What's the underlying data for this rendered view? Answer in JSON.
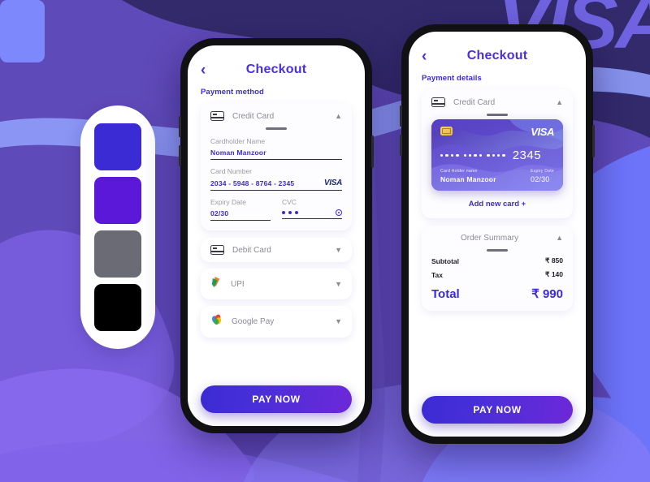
{
  "background": {
    "watermark_text": "VISA",
    "base_color": "#5f4ab9",
    "accent_light": "#6d74fa",
    "accent_dark": "#332a6b"
  },
  "palette": {
    "name": "color-swatches",
    "swatches": [
      {
        "name": "blue-violet",
        "hex": "#3b2bd4"
      },
      {
        "name": "purple",
        "hex": "#5b18d8"
      },
      {
        "name": "gray",
        "hex": "#6b6b75"
      },
      {
        "name": "black",
        "hex": "#000000"
      }
    ]
  },
  "phone1": {
    "header": {
      "back_icon": "chevron-left-icon",
      "title": "Checkout"
    },
    "section_label": "Payment method",
    "credit_card": {
      "icon": "credit-card-icon",
      "label": "Credit Card",
      "chevron": "chevron-up-icon",
      "fields": {
        "cardholder_caption": "Cardholder Name",
        "cardholder_value": "Noman Manzoor",
        "number_caption": "Card Number",
        "number_value": "2034 - 5948 - 8764 - 2345",
        "brand": "VISA",
        "expiry_caption": "Expiry Date",
        "expiry_value": "02/30",
        "cvc_caption": "CVC",
        "cvc_masked": "•••",
        "cvc_toggle_icon": "eye-icon"
      }
    },
    "methods": [
      {
        "icon": "credit-card-icon",
        "label": "Debit Card",
        "chevron": "chevron-down-icon"
      },
      {
        "icon": "upi-icon",
        "label": "UPI",
        "chevron": "chevron-down-icon"
      },
      {
        "icon": "google-pay-icon",
        "label": "Google Pay",
        "chevron": "chevron-down-icon"
      }
    ],
    "pay_button": "PAY NOW"
  },
  "phone2": {
    "header": {
      "back_icon": "chevron-left-icon",
      "title": "Checkout"
    },
    "section_label": "Payment details",
    "credit_card": {
      "icon": "credit-card-icon",
      "label": "Credit Card",
      "chevron": "chevron-up-icon",
      "visual": {
        "brand": "VISA",
        "masked_groups": [
          "••••",
          "••••",
          "••••"
        ],
        "last_four": "2345",
        "holder_caption": "Card Holder name",
        "holder_value": "Noman Manzoor",
        "expiry_caption": "Expiry Date",
        "expiry_value": "02/30"
      },
      "add_new_card": "Add new card +"
    },
    "order_summary": {
      "title": "Order Summary",
      "chevron": "chevron-up-icon",
      "lines": [
        {
          "label": "Subtotal",
          "value": "₹ 850"
        },
        {
          "label": "Tax",
          "value": "₹ 140"
        }
      ],
      "total_label": "Total",
      "total_value": "₹ 990"
    },
    "pay_button": "PAY NOW"
  }
}
